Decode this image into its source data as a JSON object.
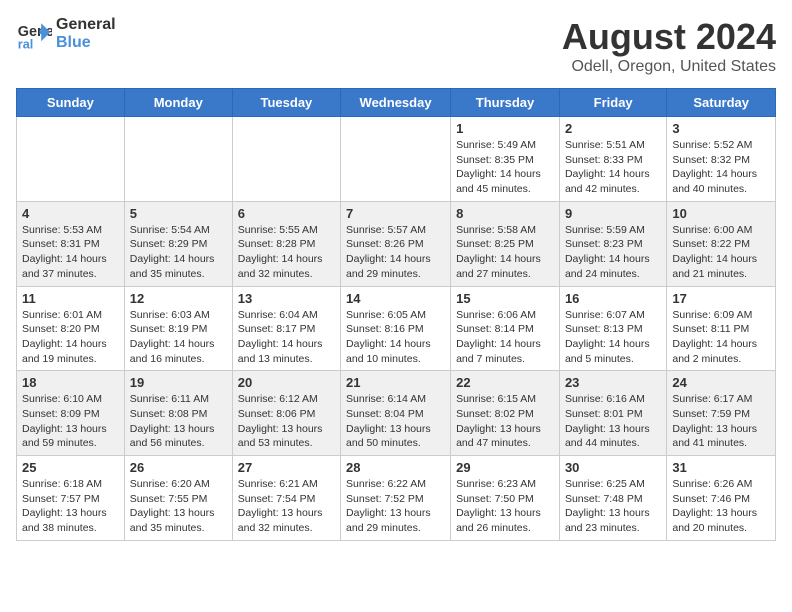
{
  "header": {
    "logo_line1": "General",
    "logo_line2": "Blue",
    "main_title": "August 2024",
    "subtitle": "Odell, Oregon, United States"
  },
  "days_of_week": [
    "Sunday",
    "Monday",
    "Tuesday",
    "Wednesday",
    "Thursday",
    "Friday",
    "Saturday"
  ],
  "weeks": [
    [
      {
        "date": "",
        "sunrise": "",
        "sunset": "",
        "daylight": ""
      },
      {
        "date": "",
        "sunrise": "",
        "sunset": "",
        "daylight": ""
      },
      {
        "date": "",
        "sunrise": "",
        "sunset": "",
        "daylight": ""
      },
      {
        "date": "",
        "sunrise": "",
        "sunset": "",
        "daylight": ""
      },
      {
        "date": "1",
        "sunrise": "Sunrise: 5:49 AM",
        "sunset": "Sunset: 8:35 PM",
        "daylight": "Daylight: 14 hours and 45 minutes."
      },
      {
        "date": "2",
        "sunrise": "Sunrise: 5:51 AM",
        "sunset": "Sunset: 8:33 PM",
        "daylight": "Daylight: 14 hours and 42 minutes."
      },
      {
        "date": "3",
        "sunrise": "Sunrise: 5:52 AM",
        "sunset": "Sunset: 8:32 PM",
        "daylight": "Daylight: 14 hours and 40 minutes."
      }
    ],
    [
      {
        "date": "4",
        "sunrise": "Sunrise: 5:53 AM",
        "sunset": "Sunset: 8:31 PM",
        "daylight": "Daylight: 14 hours and 37 minutes."
      },
      {
        "date": "5",
        "sunrise": "Sunrise: 5:54 AM",
        "sunset": "Sunset: 8:29 PM",
        "daylight": "Daylight: 14 hours and 35 minutes."
      },
      {
        "date": "6",
        "sunrise": "Sunrise: 5:55 AM",
        "sunset": "Sunset: 8:28 PM",
        "daylight": "Daylight: 14 hours and 32 minutes."
      },
      {
        "date": "7",
        "sunrise": "Sunrise: 5:57 AM",
        "sunset": "Sunset: 8:26 PM",
        "daylight": "Daylight: 14 hours and 29 minutes."
      },
      {
        "date": "8",
        "sunrise": "Sunrise: 5:58 AM",
        "sunset": "Sunset: 8:25 PM",
        "daylight": "Daylight: 14 hours and 27 minutes."
      },
      {
        "date": "9",
        "sunrise": "Sunrise: 5:59 AM",
        "sunset": "Sunset: 8:23 PM",
        "daylight": "Daylight: 14 hours and 24 minutes."
      },
      {
        "date": "10",
        "sunrise": "Sunrise: 6:00 AM",
        "sunset": "Sunset: 8:22 PM",
        "daylight": "Daylight: 14 hours and 21 minutes."
      }
    ],
    [
      {
        "date": "11",
        "sunrise": "Sunrise: 6:01 AM",
        "sunset": "Sunset: 8:20 PM",
        "daylight": "Daylight: 14 hours and 19 minutes."
      },
      {
        "date": "12",
        "sunrise": "Sunrise: 6:03 AM",
        "sunset": "Sunset: 8:19 PM",
        "daylight": "Daylight: 14 hours and 16 minutes."
      },
      {
        "date": "13",
        "sunrise": "Sunrise: 6:04 AM",
        "sunset": "Sunset: 8:17 PM",
        "daylight": "Daylight: 14 hours and 13 minutes."
      },
      {
        "date": "14",
        "sunrise": "Sunrise: 6:05 AM",
        "sunset": "Sunset: 8:16 PM",
        "daylight": "Daylight: 14 hours and 10 minutes."
      },
      {
        "date": "15",
        "sunrise": "Sunrise: 6:06 AM",
        "sunset": "Sunset: 8:14 PM",
        "daylight": "Daylight: 14 hours and 7 minutes."
      },
      {
        "date": "16",
        "sunrise": "Sunrise: 6:07 AM",
        "sunset": "Sunset: 8:13 PM",
        "daylight": "Daylight: 14 hours and 5 minutes."
      },
      {
        "date": "17",
        "sunrise": "Sunrise: 6:09 AM",
        "sunset": "Sunset: 8:11 PM",
        "daylight": "Daylight: 14 hours and 2 minutes."
      }
    ],
    [
      {
        "date": "18",
        "sunrise": "Sunrise: 6:10 AM",
        "sunset": "Sunset: 8:09 PM",
        "daylight": "Daylight: 13 hours and 59 minutes."
      },
      {
        "date": "19",
        "sunrise": "Sunrise: 6:11 AM",
        "sunset": "Sunset: 8:08 PM",
        "daylight": "Daylight: 13 hours and 56 minutes."
      },
      {
        "date": "20",
        "sunrise": "Sunrise: 6:12 AM",
        "sunset": "Sunset: 8:06 PM",
        "daylight": "Daylight: 13 hours and 53 minutes."
      },
      {
        "date": "21",
        "sunrise": "Sunrise: 6:14 AM",
        "sunset": "Sunset: 8:04 PM",
        "daylight": "Daylight: 13 hours and 50 minutes."
      },
      {
        "date": "22",
        "sunrise": "Sunrise: 6:15 AM",
        "sunset": "Sunset: 8:02 PM",
        "daylight": "Daylight: 13 hours and 47 minutes."
      },
      {
        "date": "23",
        "sunrise": "Sunrise: 6:16 AM",
        "sunset": "Sunset: 8:01 PM",
        "daylight": "Daylight: 13 hours and 44 minutes."
      },
      {
        "date": "24",
        "sunrise": "Sunrise: 6:17 AM",
        "sunset": "Sunset: 7:59 PM",
        "daylight": "Daylight: 13 hours and 41 minutes."
      }
    ],
    [
      {
        "date": "25",
        "sunrise": "Sunrise: 6:18 AM",
        "sunset": "Sunset: 7:57 PM",
        "daylight": "Daylight: 13 hours and 38 minutes."
      },
      {
        "date": "26",
        "sunrise": "Sunrise: 6:20 AM",
        "sunset": "Sunset: 7:55 PM",
        "daylight": "Daylight: 13 hours and 35 minutes."
      },
      {
        "date": "27",
        "sunrise": "Sunrise: 6:21 AM",
        "sunset": "Sunset: 7:54 PM",
        "daylight": "Daylight: 13 hours and 32 minutes."
      },
      {
        "date": "28",
        "sunrise": "Sunrise: 6:22 AM",
        "sunset": "Sunset: 7:52 PM",
        "daylight": "Daylight: 13 hours and 29 minutes."
      },
      {
        "date": "29",
        "sunrise": "Sunrise: 6:23 AM",
        "sunset": "Sunset: 7:50 PM",
        "daylight": "Daylight: 13 hours and 26 minutes."
      },
      {
        "date": "30",
        "sunrise": "Sunrise: 6:25 AM",
        "sunset": "Sunset: 7:48 PM",
        "daylight": "Daylight: 13 hours and 23 minutes."
      },
      {
        "date": "31",
        "sunrise": "Sunrise: 6:26 AM",
        "sunset": "Sunset: 7:46 PM",
        "daylight": "Daylight: 13 hours and 20 minutes."
      }
    ]
  ]
}
